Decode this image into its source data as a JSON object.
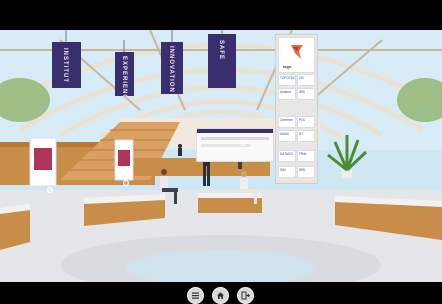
{
  "scene": {
    "name": "virtual exhibition hall",
    "banners": [
      {
        "text": "INSTITUT"
      },
      {
        "text": "EXPERIENCE"
      },
      {
        "text": "INNOVATION"
      },
      {
        "text": "SAFE"
      }
    ],
    "sign_logo": "logo",
    "sponsor_tiles": [
      {
        "text": "TOPOTEC"
      },
      {
        "text": "OS"
      },
      {
        "text": "Amitour"
      },
      {
        "text": "iRIS"
      },
      {
        "text": "Ceremex"
      },
      {
        "text": "POL"
      },
      {
        "text": "AIAMI"
      },
      {
        "text": "NT"
      },
      {
        "text": "DATAGO"
      },
      {
        "text": "FRAL"
      },
      {
        "text": "SIM"
      },
      {
        "text": "WID"
      }
    ]
  },
  "toolbar": {
    "buttons": [
      {
        "icon": "menu-icon"
      },
      {
        "icon": "home-icon"
      },
      {
        "icon": "exit-icon"
      }
    ]
  },
  "colors": {
    "banner": "#3a2f6e",
    "floor": "#e4e6ea",
    "wood": "#c98d4a",
    "sky": "#cfe6f3",
    "toolbar_button": "#d9d9d9"
  }
}
